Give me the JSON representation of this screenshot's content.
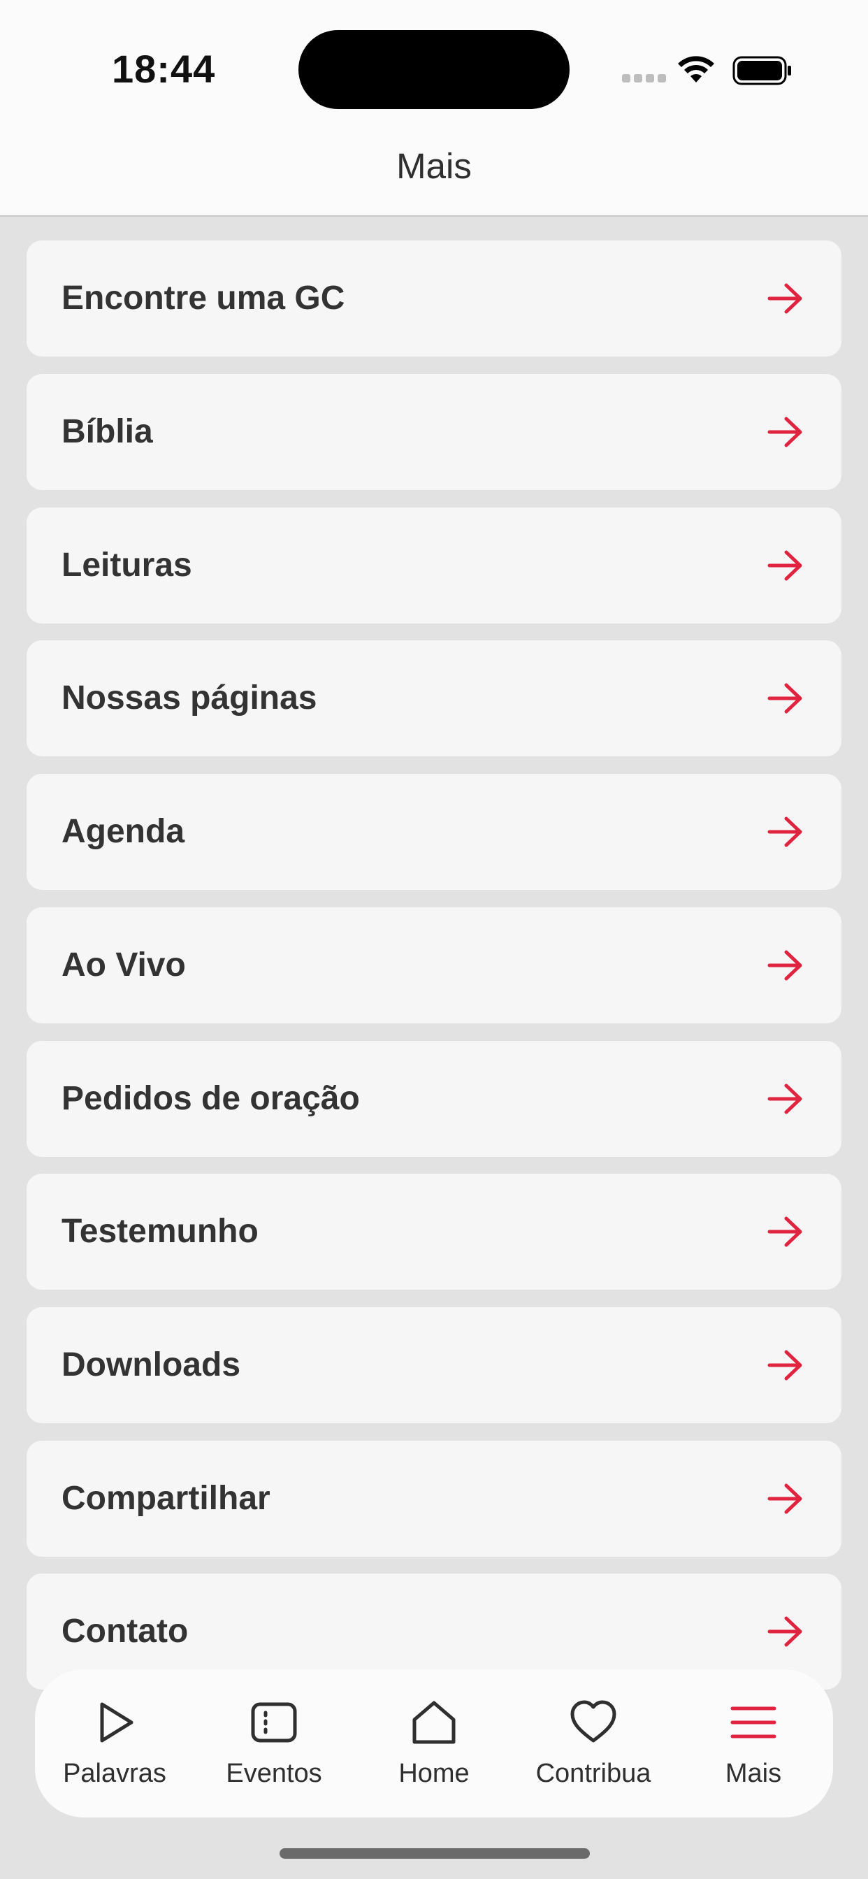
{
  "status_bar": {
    "time": "18:44"
  },
  "header": {
    "title": "Mais"
  },
  "menu": [
    {
      "label": "Encontre uma GC"
    },
    {
      "label": "Bíblia"
    },
    {
      "label": "Leituras"
    },
    {
      "label": "Nossas páginas"
    },
    {
      "label": "Agenda"
    },
    {
      "label": "Ao Vivo"
    },
    {
      "label": "Pedidos de oração"
    },
    {
      "label": "Testemunho"
    },
    {
      "label": "Downloads"
    },
    {
      "label": "Compartilhar"
    },
    {
      "label": "Contato"
    }
  ],
  "tabbar": [
    {
      "label": "Palavras",
      "icon": "play-icon"
    },
    {
      "label": "Eventos",
      "icon": "ticket-icon"
    },
    {
      "label": "Home",
      "icon": "home-icon"
    },
    {
      "label": "Contribua",
      "icon": "heart-icon"
    },
    {
      "label": "Mais",
      "icon": "menu-icon",
      "active": true
    }
  ],
  "colors": {
    "accent": "#e0233f",
    "text": "#333333",
    "card": "#f6f6f6",
    "background": "#e2e2e2"
  }
}
